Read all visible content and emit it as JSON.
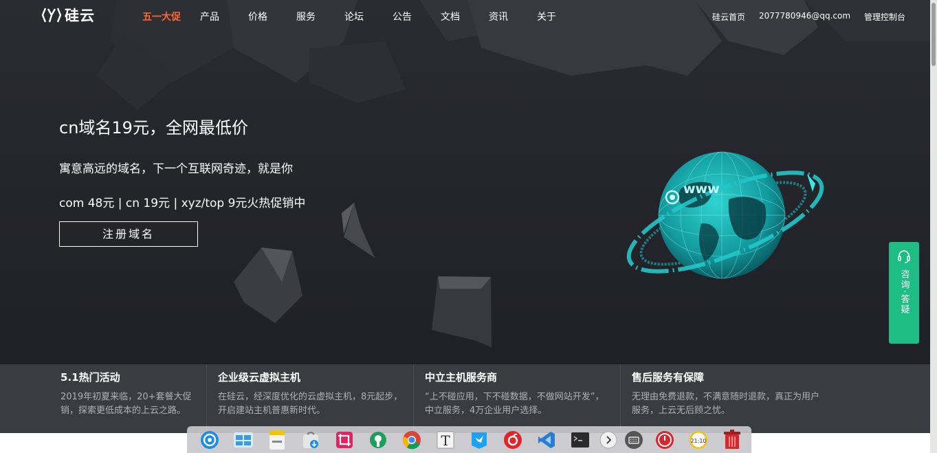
{
  "brand": {
    "name": "硅云"
  },
  "nav": {
    "items": [
      {
        "label": "五一大促"
      },
      {
        "label": "产品"
      },
      {
        "label": "价格"
      },
      {
        "label": "服务"
      },
      {
        "label": "论坛"
      },
      {
        "label": "公告"
      },
      {
        "label": "文档"
      },
      {
        "label": "资讯"
      },
      {
        "label": "关于"
      }
    ],
    "active_color": "#ff6a2a"
  },
  "account": {
    "home_label": "硅云首页",
    "email": "2077780946@qq.com",
    "console_label": "管理控制台"
  },
  "hero": {
    "title": "cn域名19元，全网最低价",
    "subtitle": "寓意高远的域名，下一个互联网奇迹，就是你",
    "prices": "com 48元 | cn 19元 | xyz/top 9元火热促销中",
    "button_label": "注册域名",
    "globe_text": "www",
    "accent_color": "#22c7c9"
  },
  "consult": {
    "label": "咨询·答疑",
    "color": "#1fbd86"
  },
  "features": [
    {
      "title": "5.1热门活动",
      "desc": "2019年初夏来临，20+套餐大促销，探索更低成本的上云之路。"
    },
    {
      "title": "企业级云虚拟主机",
      "desc": "在硅云，经深度优化的云虚拟主机，8元起步，开启建站主机普惠新时代。"
    },
    {
      "title": "中立主机服务商",
      "desc": "“上不碰应用，下不碰数据，不做网站开发”，中立服务，4万企业用户选择。"
    },
    {
      "title": "售后服务有保障",
      "desc": "无理由免费退款，不满意随时退款，真正为用户服务，上云无后顾之忧。"
    }
  ],
  "dock": {
    "items": [
      {
        "icon": "deepin-launcher-icon"
      },
      {
        "icon": "multitask-view-icon"
      },
      {
        "icon": "file-manager-icon"
      },
      {
        "icon": "app-store-icon"
      },
      {
        "icon": "screenshot-icon"
      },
      {
        "icon": "settings-icon"
      },
      {
        "icon": "chrome-icon"
      },
      {
        "icon": "typora-icon"
      },
      {
        "icon": "bird-app-icon"
      },
      {
        "icon": "netease-music-icon"
      },
      {
        "icon": "vscode-icon"
      },
      {
        "icon": "terminal-icon"
      },
      {
        "icon": "expand-arrow-icon"
      },
      {
        "icon": "keyboard-icon"
      },
      {
        "icon": "power-icon"
      },
      {
        "icon": "clock-icon"
      },
      {
        "icon": "trash-icon"
      }
    ],
    "clock_text": "21:10"
  }
}
